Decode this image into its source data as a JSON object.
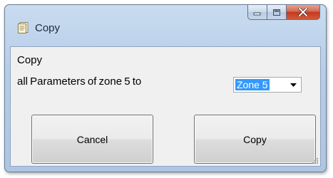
{
  "window": {
    "title": "Copy",
    "title_icon": "document-icon",
    "controls": {
      "minimize_icon": "minimize-icon",
      "maximize_icon": "maximize-icon",
      "close_icon": "close-icon"
    }
  },
  "dialog": {
    "heading": "Copy",
    "message": "all Parameters of zone 5 to",
    "target_zone": {
      "selected": "Zone 5",
      "dropdown_icon": "chevron-down-icon"
    },
    "buttons": {
      "cancel_label": "Cancel",
      "copy_label": "Copy"
    },
    "resize_grip_icon": "resize-grip-icon"
  },
  "colors": {
    "selection": "#3399ff",
    "close_button": "#c73b1f",
    "title_bar": "#b9d1ea"
  }
}
